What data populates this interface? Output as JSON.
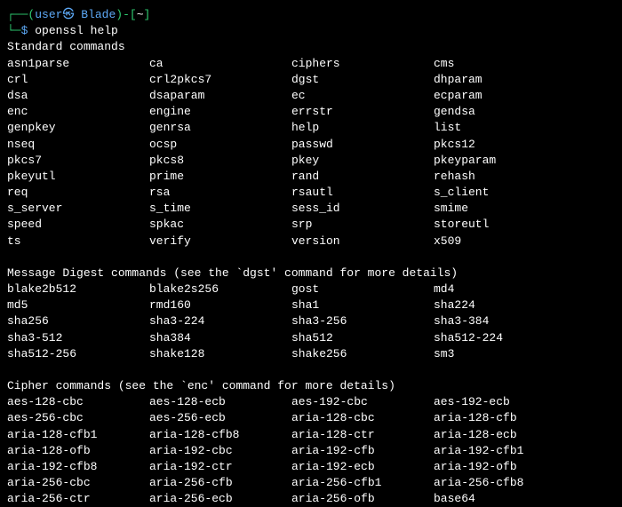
{
  "prompt": {
    "user": "user",
    "at": "㉿",
    "host": "Blade",
    "path": "~",
    "dollar": "$",
    "command": "openssl help"
  },
  "sections": {
    "standard": {
      "header": "Standard commands",
      "rows": [
        [
          "asn1parse",
          "ca",
          "ciphers",
          "cms"
        ],
        [
          "crl",
          "crl2pkcs7",
          "dgst",
          "dhparam"
        ],
        [
          "dsa",
          "dsaparam",
          "ec",
          "ecparam"
        ],
        [
          "enc",
          "engine",
          "errstr",
          "gendsa"
        ],
        [
          "genpkey",
          "genrsa",
          "help",
          "list"
        ],
        [
          "nseq",
          "ocsp",
          "passwd",
          "pkcs12"
        ],
        [
          "pkcs7",
          "pkcs8",
          "pkey",
          "pkeyparam"
        ],
        [
          "pkeyutl",
          "prime",
          "rand",
          "rehash"
        ],
        [
          "req",
          "rsa",
          "rsautl",
          "s_client"
        ],
        [
          "s_server",
          "s_time",
          "sess_id",
          "smime"
        ],
        [
          "speed",
          "spkac",
          "srp",
          "storeutl"
        ],
        [
          "ts",
          "verify",
          "version",
          "x509"
        ]
      ]
    },
    "digest": {
      "header": "Message Digest commands (see the `dgst' command for more details)",
      "rows": [
        [
          "blake2b512",
          "blake2s256",
          "gost",
          "md4"
        ],
        [
          "md5",
          "rmd160",
          "sha1",
          "sha224"
        ],
        [
          "sha256",
          "sha3-224",
          "sha3-256",
          "sha3-384"
        ],
        [
          "sha3-512",
          "sha384",
          "sha512",
          "sha512-224"
        ],
        [
          "sha512-256",
          "shake128",
          "shake256",
          "sm3"
        ]
      ]
    },
    "cipher": {
      "header": "Cipher commands (see the `enc' command for more details)",
      "rows": [
        [
          "aes-128-cbc",
          "aes-128-ecb",
          "aes-192-cbc",
          "aes-192-ecb"
        ],
        [
          "aes-256-cbc",
          "aes-256-ecb",
          "aria-128-cbc",
          "aria-128-cfb"
        ],
        [
          "aria-128-cfb1",
          "aria-128-cfb8",
          "aria-128-ctr",
          "aria-128-ecb"
        ],
        [
          "aria-128-ofb",
          "aria-192-cbc",
          "aria-192-cfb",
          "aria-192-cfb1"
        ],
        [
          "aria-192-cfb8",
          "aria-192-ctr",
          "aria-192-ecb",
          "aria-192-ofb"
        ],
        [
          "aria-256-cbc",
          "aria-256-cfb",
          "aria-256-cfb1",
          "aria-256-cfb8"
        ],
        [
          "aria-256-ctr",
          "aria-256-ecb",
          "aria-256-ofb",
          "base64"
        ]
      ]
    }
  }
}
